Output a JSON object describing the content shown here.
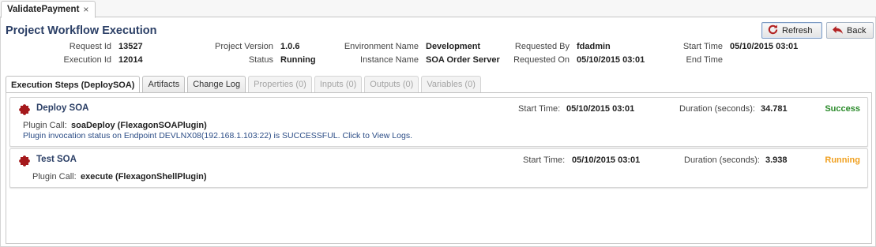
{
  "doc_tab": {
    "label": "ValidatePayment",
    "close": "×"
  },
  "page_title": "Project Workflow Execution",
  "buttons": {
    "refresh": "Refresh",
    "back": "Back"
  },
  "info": {
    "request_id_label": "Request Id",
    "request_id": "13527",
    "execution_id_label": "Execution Id",
    "execution_id": "12014",
    "project_version_label": "Project Version",
    "project_version": "1.0.6",
    "status_label": "Status",
    "status": "Running",
    "environment_name_label": "Environment Name",
    "environment_name": "Development",
    "instance_name_label": "Instance Name",
    "instance_name": "SOA Order Server",
    "requested_by_label": "Requested By",
    "requested_by": "fdadmin",
    "requested_on_label": "Requested On",
    "requested_on": "05/10/2015 03:01",
    "start_time_label": "Start Time",
    "start_time": "05/10/2015 03:01",
    "end_time_label": "End Time",
    "end_time": ""
  },
  "tabs": [
    {
      "label": "Execution Steps (DeploySOA)",
      "state": "active"
    },
    {
      "label": "Artifacts",
      "state": "normal"
    },
    {
      "label": "Change Log",
      "state": "normal"
    },
    {
      "label": "Properties (0)",
      "state": "disabled"
    },
    {
      "label": "Inputs (0)",
      "state": "disabled"
    },
    {
      "label": "Outputs (0)",
      "state": "disabled"
    },
    {
      "label": "Variables (0)",
      "state": "disabled"
    }
  ],
  "steps": [
    {
      "name": "Deploy SOA",
      "plugin_call_label": "Plugin Call:",
      "plugin_call": "soaDeploy (FlexagonSOAPlugin)",
      "log_link": "Plugin invocation status on Endpoint DEVLNX08(192.168.1.103:22) is SUCCESSFUL. Click to View Logs.",
      "start_time_label": "Start Time:",
      "start_time": "05/10/2015 03:01",
      "duration_label": "Duration (seconds):",
      "duration": "34.781",
      "status": "Success"
    },
    {
      "name": "Test SOA",
      "plugin_call_label": "Plugin Call:",
      "plugin_call": "execute (FlexagonShellPlugin)",
      "start_time_label": "Start Time:",
      "start_time": "05/10/2015 03:01",
      "duration_label": "Duration (seconds):",
      "duration": "3.938",
      "status": "Running"
    }
  ],
  "colors": {
    "title_blue": "#2b3f66",
    "success": "#2a8a2a",
    "running": "#f0a020",
    "plugin_icon": "#a5191c"
  },
  "icons": {
    "refresh": "refresh-icon",
    "back": "back-arrow-icon",
    "step": "puzzle-piece-icon",
    "close": "close-icon"
  }
}
